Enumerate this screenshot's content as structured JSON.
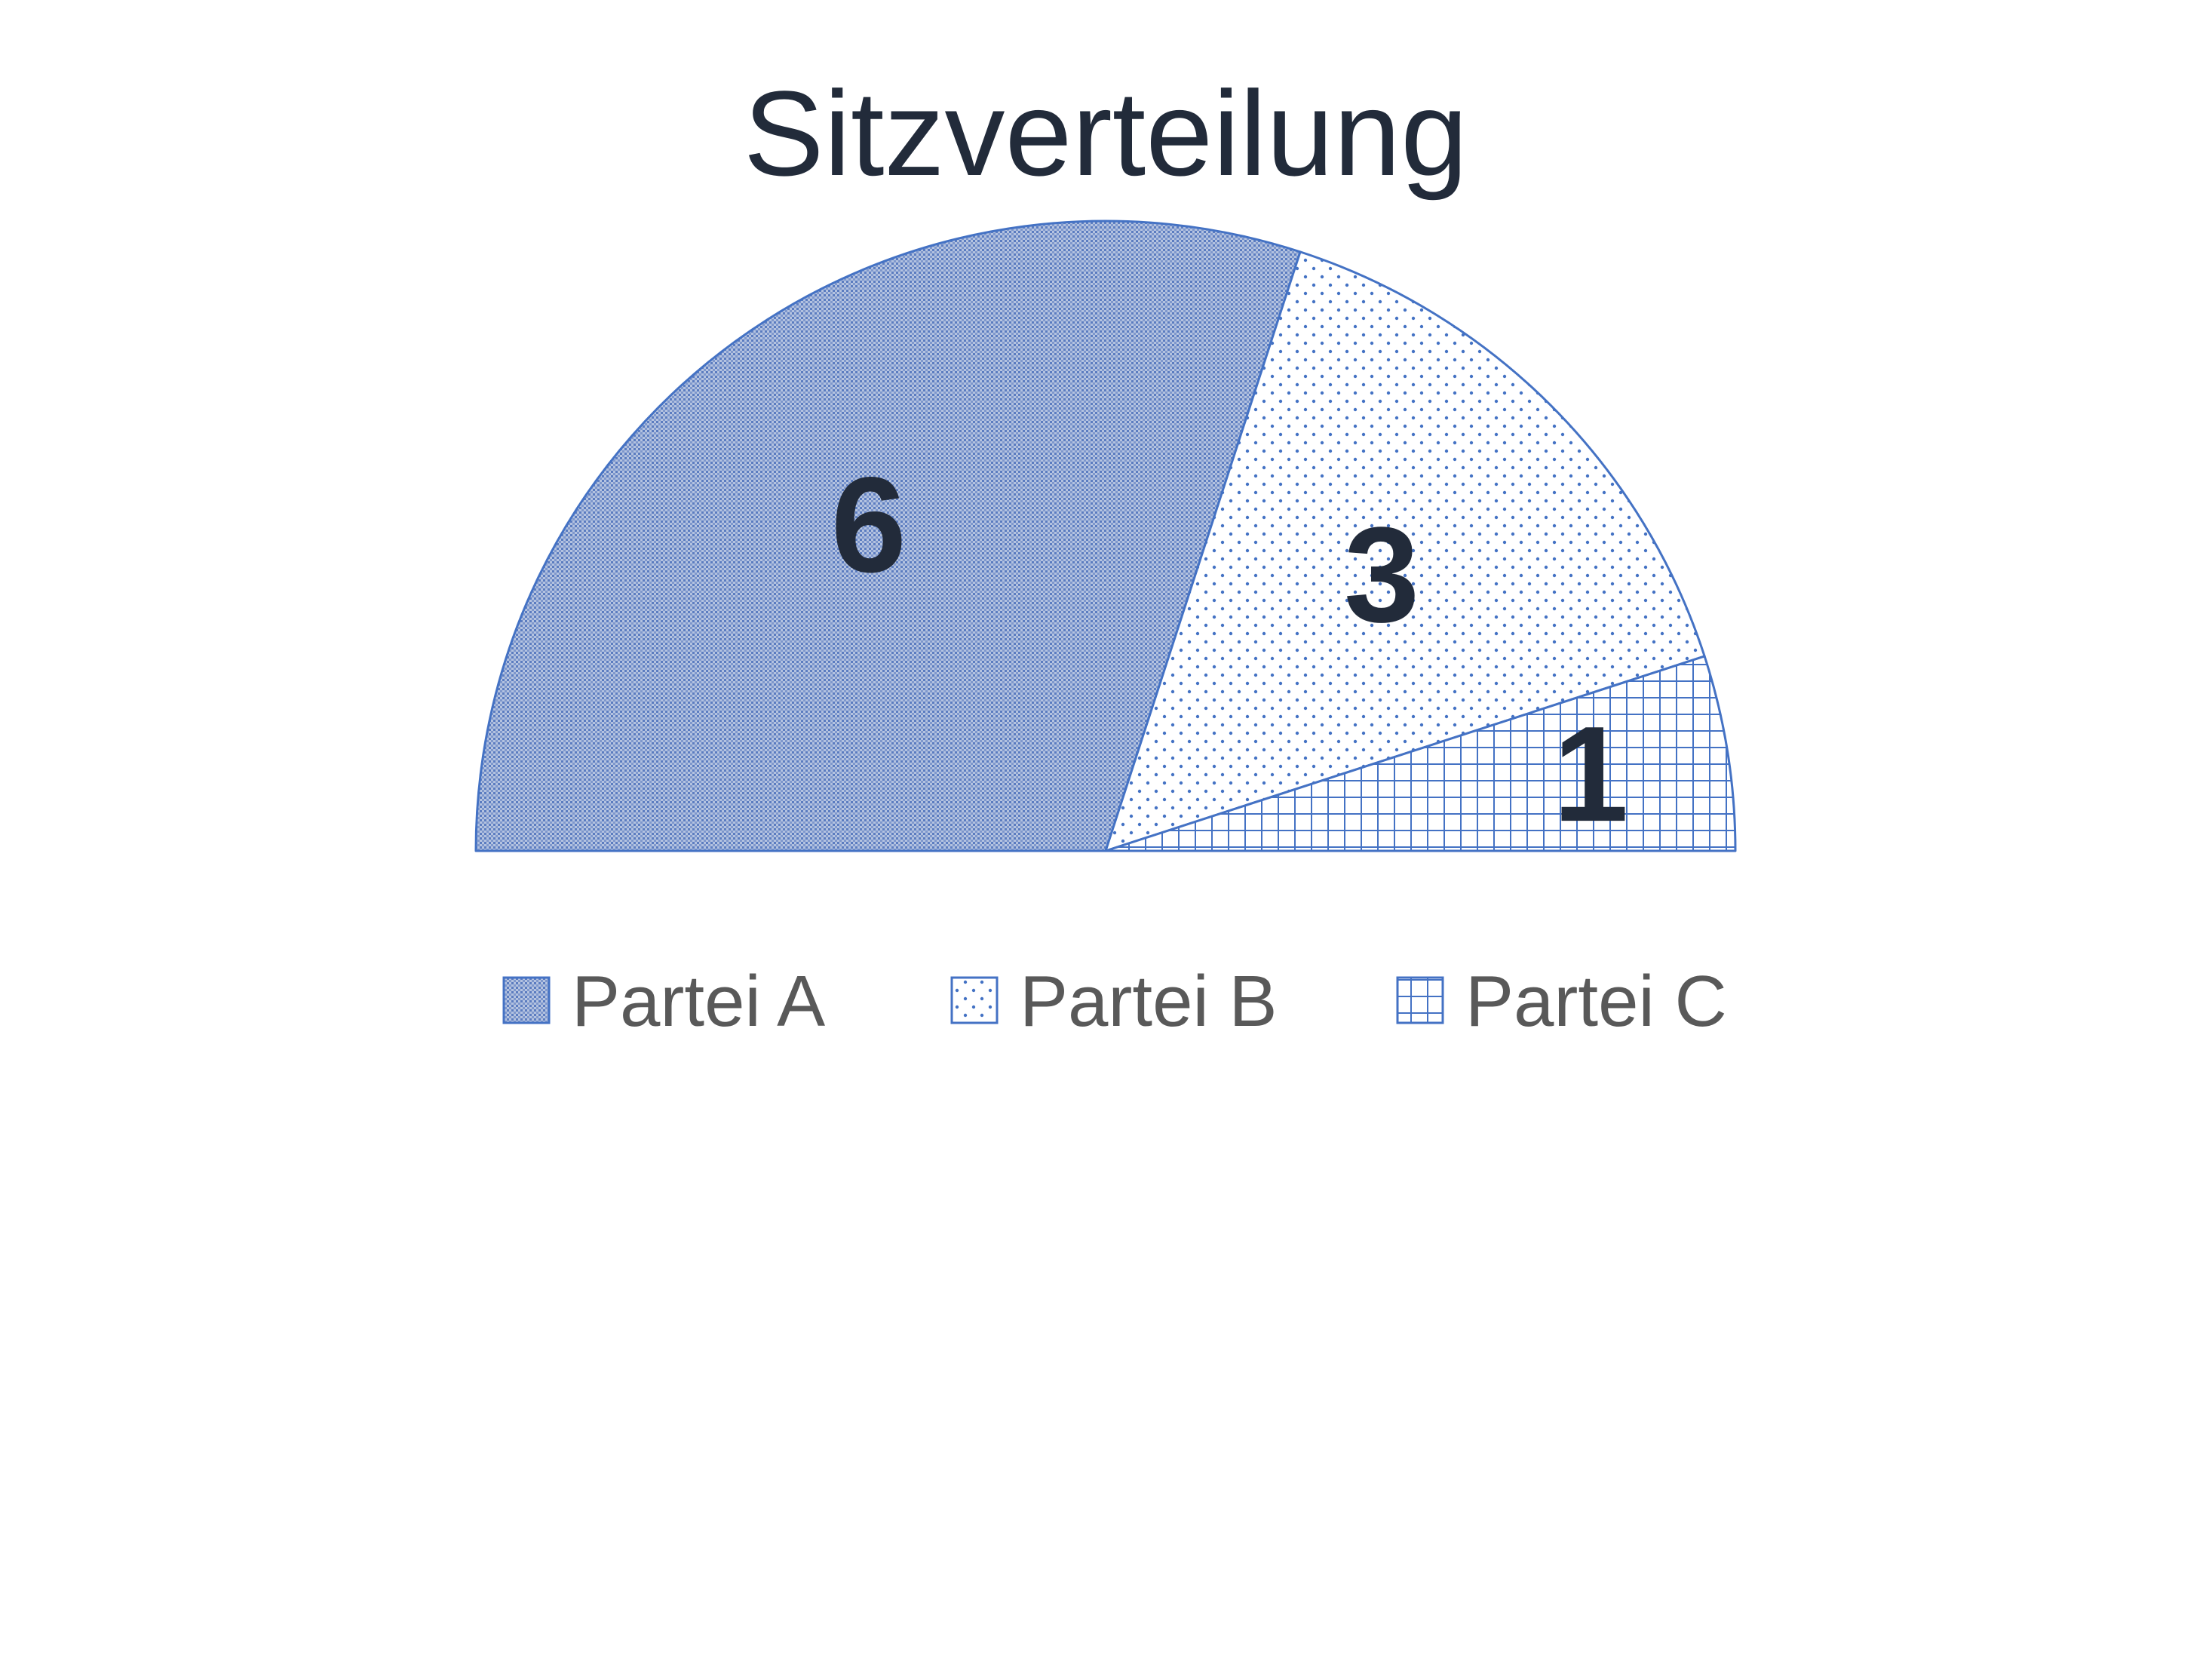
{
  "chart_data": {
    "type": "pie",
    "variant": "half-donut-parliament",
    "title": "Sitzverteilung",
    "categories": [
      "Partei A",
      "Partei B",
      "Partei C"
    ],
    "values": [
      6,
      3,
      1
    ],
    "data_labels": [
      "6",
      "3",
      "1"
    ],
    "legend": {
      "position": "bottom",
      "entries": [
        "Partei A",
        "Partei B",
        "Partei C"
      ]
    },
    "series_patterns": [
      "fine-dense-dots",
      "sparse-dots",
      "grid"
    ],
    "colors": {
      "accent": "#4472c4",
      "title": "#222b3a",
      "labels": "#222b3a",
      "legend_text": "#595959"
    }
  }
}
